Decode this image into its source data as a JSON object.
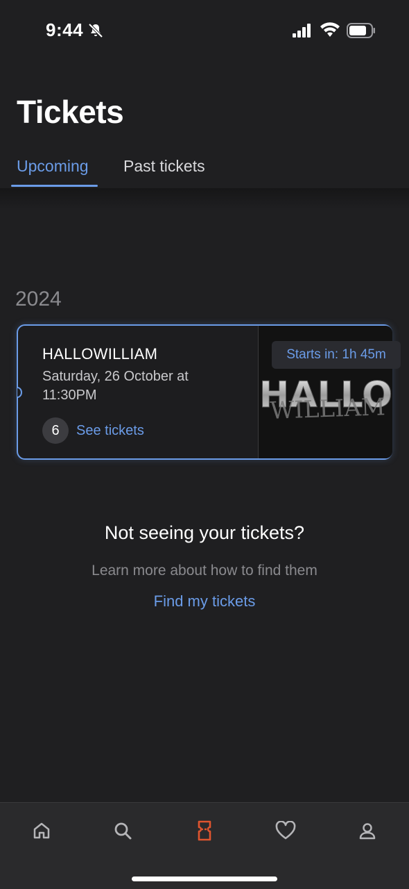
{
  "status_bar": {
    "time": "9:44"
  },
  "header": {
    "title": "Tickets",
    "tabs": [
      {
        "label": "Upcoming",
        "active": true
      },
      {
        "label": "Past tickets",
        "active": false
      }
    ]
  },
  "year_section": "2024",
  "ticket": {
    "event_name": "HALLOWILLIAM",
    "date_line": "Saturday, 26 October at 11:30PM",
    "ticket_count": "6",
    "see_tickets_label": "See tickets",
    "countdown": "Starts in: 1h 45m",
    "poster_text_top": "HALLO",
    "poster_text_bottom": "WILLIAM"
  },
  "help": {
    "heading": "Not seeing your tickets?",
    "subtext": "Learn more about how to find them",
    "link": "Find my tickets"
  },
  "bottom_nav": [
    {
      "icon": "home-icon",
      "active": false
    },
    {
      "icon": "search-icon",
      "active": false
    },
    {
      "icon": "ticket-icon",
      "active": true
    },
    {
      "icon": "heart-icon",
      "active": false
    },
    {
      "icon": "profile-icon",
      "active": false
    }
  ],
  "colors": {
    "accent": "#6b9ce8",
    "active_nav": "#e0552f",
    "background": "#1f1f21"
  }
}
